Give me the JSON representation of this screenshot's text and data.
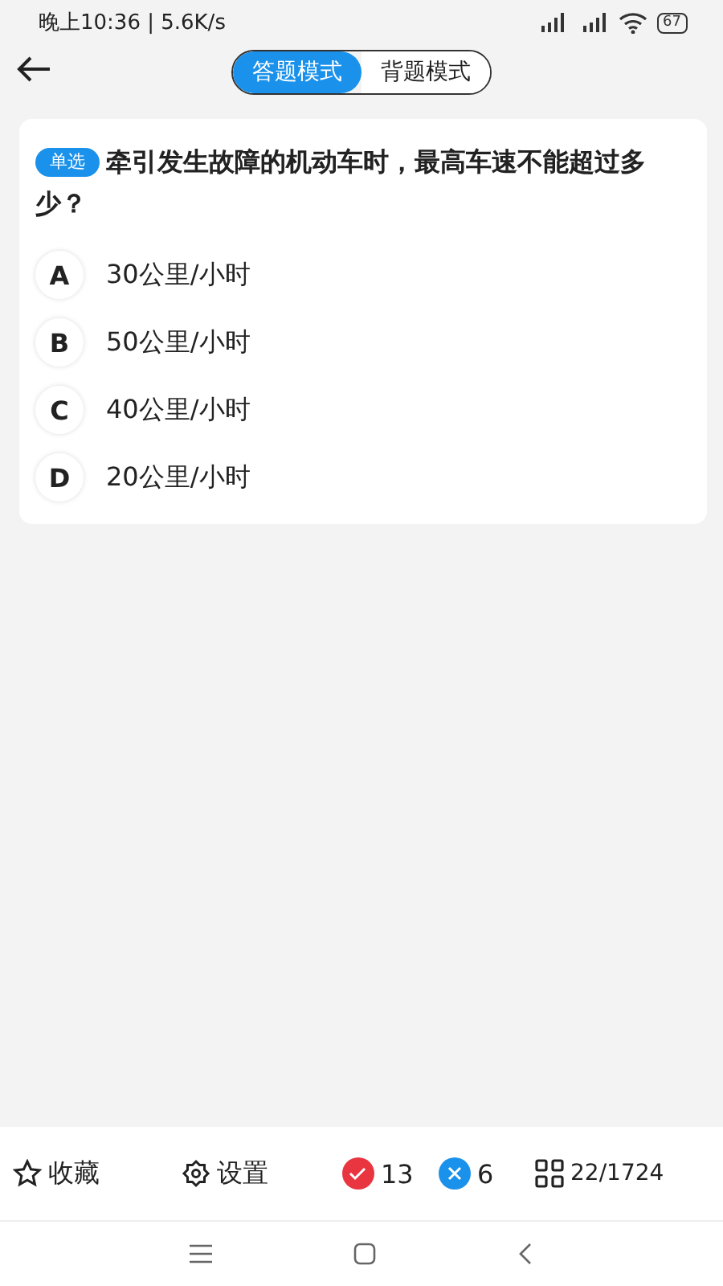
{
  "status_bar": {
    "time": "晚上10:36 | 5.6K/s",
    "battery": "67"
  },
  "mode_tabs": [
    {
      "label": "答题模式",
      "selected": true
    },
    {
      "label": "背题模式",
      "selected": false
    }
  ],
  "question": {
    "type_badge": "单选",
    "text": "牵引发生故障的机动车时，最高车速不能超过多少？",
    "options": [
      {
        "letter": "A",
        "text": "30公里/小时"
      },
      {
        "letter": "B",
        "text": "50公里/小时"
      },
      {
        "letter": "C",
        "text": "40公里/小时"
      },
      {
        "letter": "D",
        "text": "20公里/小时"
      }
    ]
  },
  "bottom_bar": {
    "favorite": "收藏",
    "settings": "设置",
    "correct_count": "13",
    "wrong_count": "6",
    "progress": "22/1724"
  }
}
